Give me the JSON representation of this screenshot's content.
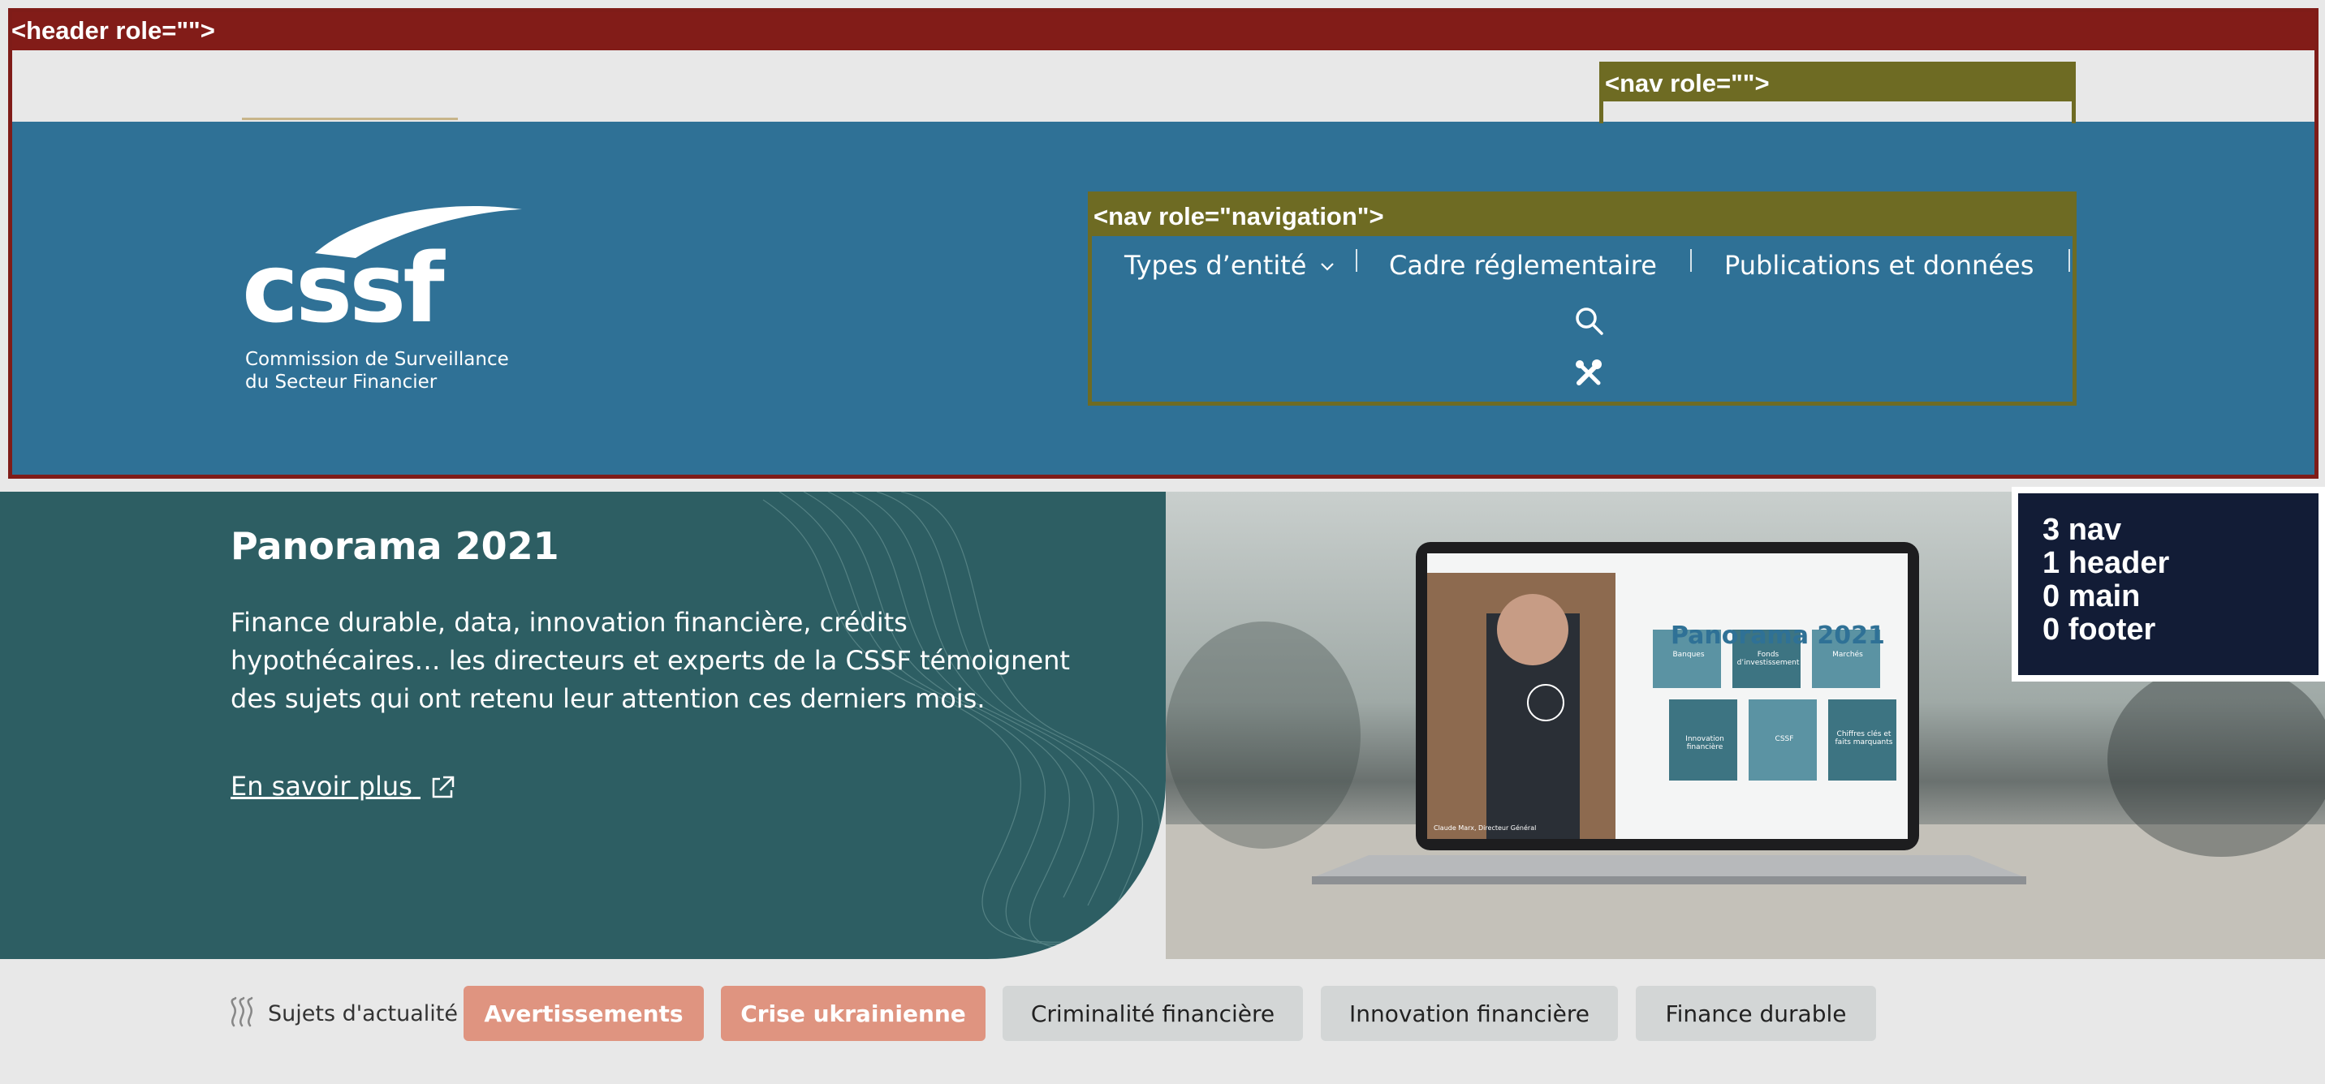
{
  "overlay": {
    "header_tag": "<header role=\"\">",
    "top_nav_tag": "<nav role=\"\">",
    "main_nav_tag": "<nav role=\"navigation\">",
    "counts": [
      "3 nav",
      "1 header",
      "0 main",
      "0 footer"
    ]
  },
  "logo": {
    "word": "cssf",
    "line1": "Commission de Surveillance",
    "line2": "du Secteur Financier"
  },
  "nav": {
    "items": [
      {
        "label": "Types d’entité"
      },
      {
        "label": "Cadre réglementaire"
      },
      {
        "label": "Publications et données"
      }
    ],
    "icons": [
      "search-icon",
      "tools-icon"
    ]
  },
  "hero": {
    "title": "Panorama 2021",
    "description": "Finance durable, data, innovation financière, crédits hypothécaires… les directeurs et experts de la CSSF témoignent des sujets qui ont retenu leur attention ces derniers mois.",
    "link": "En savoir plus",
    "screen": {
      "title": "Panorama 2021",
      "tiles": [
        "Banques",
        "Fonds d’investissement",
        "Marchés",
        "Innovation financière",
        "CSSF",
        "Chiffres clés et faits marquants"
      ],
      "caption": "Claude Marx, Directeur Général"
    }
  },
  "topics": {
    "label": "Sujets d'actualité",
    "chips": [
      {
        "label": "Avertissements",
        "style": "hot"
      },
      {
        "label": "Crise ukrainienne",
        "style": "hot"
      },
      {
        "label": "Criminalité financière",
        "style": "cold"
      },
      {
        "label": "Innovation financière",
        "style": "cold"
      },
      {
        "label": "Finance durable",
        "style": "cold"
      }
    ]
  },
  "colors": {
    "header_blue": "#2f7196",
    "hero_teal": "#2d5e63",
    "chip_hot": "#df9480",
    "chip_cold": "#d3d6d6",
    "overlay_header": "#821c18",
    "overlay_nav": "#6e6b23",
    "overlay_count": "#121c36"
  }
}
